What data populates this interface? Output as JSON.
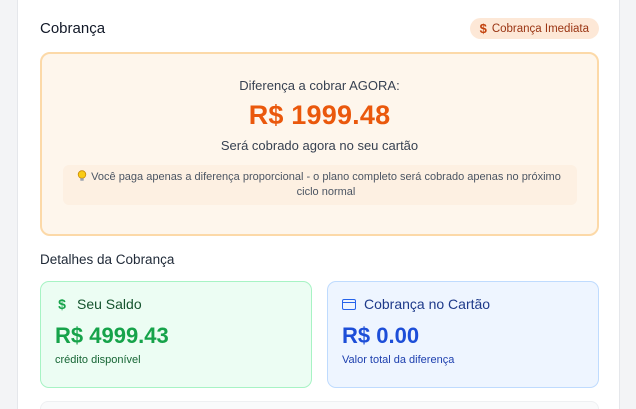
{
  "header": {
    "title": "Cobrança",
    "badge_icon": "$",
    "badge_label": "Cobrança Imediata"
  },
  "due": {
    "label": "Diferença a cobrar AGORA:",
    "amount": "R$ 1999.48",
    "subtitle": "Será cobrado agora no seu cartão",
    "tip_icon": "lightbulb-icon",
    "tip": "Você paga apenas a diferença proporcional - o plano completo será cobrado apenas no próximo ciclo normal"
  },
  "details": {
    "title": "Detalhes da Cobrança",
    "balance": {
      "icon": "$",
      "label": "Seu Saldo",
      "value": "R$ 4999.43",
      "caption": "crédito disponível"
    },
    "card_charge": {
      "icon": "credit-card-icon",
      "label": "Cobrança no Cartão",
      "value": "R$ 0.00",
      "caption": "Valor total da diferença"
    }
  },
  "colors": {
    "accent_orange": "#ea580c",
    "green": "#16a34a",
    "blue": "#1d4ed8"
  }
}
